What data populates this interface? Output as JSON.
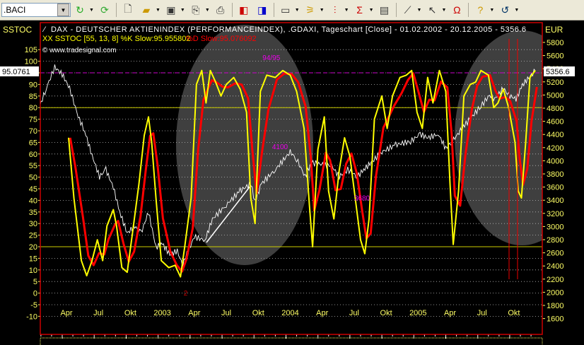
{
  "toolbar": {
    "symbol": ".BACI",
    "icons": [
      "go-arrow-icon",
      "refresh-icon",
      "new-document-icon",
      "open-folder-icon",
      "save-icon",
      "copy-icon",
      "print-icon",
      "chart-prev-icon",
      "chart-next-icon",
      "window-icon",
      "indicator-icon",
      "candlestick-icon",
      "sigma-icon",
      "properties-icon",
      "draw-line-icon",
      "cursor-icon",
      "magnet-icon",
      "help-icon",
      "undo-icon"
    ]
  },
  "colors": {
    "k": "#ffff00",
    "d": "#ff0000",
    "dax": "#ffffff",
    "level95": "#cc00cc",
    "frame": "#cc0000",
    "axis": "#ffff66"
  },
  "chart_data": {
    "type": "line",
    "title": "DAX - DEUTSCHER AKTIENINDEX (PERFORMANCEINDEX), .GDAXI, Tageschart [Close] - 01.02.2002 - 20.12.2005 - 5356.6",
    "indicator_legend": "XX SSTOC [55, 13, 8] %K Slow:95.955802",
    "indicator_legend_d": "%D Slow:95.076092",
    "copyright": "© www.tradesignal.com",
    "left_axis_title": "SSTOC",
    "right_axis_title": "EUR",
    "left_current": "95.0761",
    "right_current": "5356.6",
    "left_ticks": [
      105,
      100,
      95,
      90,
      85,
      80,
      75,
      70,
      65,
      60,
      55,
      50,
      45,
      40,
      35,
      30,
      25,
      20,
      15,
      10,
      5,
      0,
      -5,
      -10
    ],
    "right_ticks": [
      5800,
      5600,
      5400,
      5200,
      5000,
      4800,
      4600,
      4400,
      4200,
      4000,
      3800,
      3600,
      3400,
      3200,
      3000,
      2800,
      2600,
      2400,
      2200,
      2000,
      1800,
      1600
    ],
    "x_labels": [
      {
        "m": 3,
        "t": "Apr"
      },
      {
        "m": 6,
        "t": "Jul"
      },
      {
        "m": 9,
        "t": "Okt"
      },
      {
        "m": 12,
        "t": "2003"
      },
      {
        "m": 15,
        "t": "Apr"
      },
      {
        "m": 18,
        "t": "Jul"
      },
      {
        "m": 21,
        "t": "Okt"
      },
      {
        "m": 24,
        "t": "2004"
      },
      {
        "m": 27,
        "t": "Apr"
      },
      {
        "m": 30,
        "t": "Jul"
      },
      {
        "m": 33,
        "t": "Okt"
      },
      {
        "m": 36,
        "t": "2005"
      },
      {
        "m": 39,
        "t": "Apr"
      },
      {
        "m": 42,
        "t": "Jul"
      },
      {
        "m": 45,
        "t": "Okt"
      }
    ],
    "x_unit": "months since Jan 2002",
    "levels": [
      {
        "v": 95,
        "style": "dashed-magenta"
      },
      {
        "v": 80,
        "style": "yellow"
      },
      {
        "v": 20,
        "style": "yellow"
      }
    ],
    "annotations": [
      {
        "t": "94/95",
        "m": 21.4,
        "v": 100.5
      },
      {
        "t": "4100",
        "m": 22.3,
        "v": 62
      },
      {
        "t": "3680",
        "m": 30,
        "v": 40
      },
      {
        "t": "2",
        "m": 14.0,
        "v": -1
      }
    ],
    "series": [
      {
        "name": "%K Slow",
        "axis": "left",
        "points": [
          [
            3.2,
            67
          ],
          [
            3.7,
            41
          ],
          [
            4.4,
            14
          ],
          [
            4.9,
            7.5
          ],
          [
            5.4,
            14
          ],
          [
            5.9,
            23
          ],
          [
            6.4,
            14
          ],
          [
            6.8,
            29
          ],
          [
            7.4,
            36
          ],
          [
            7.7,
            29
          ],
          [
            8.2,
            11
          ],
          [
            8.7,
            9
          ],
          [
            9.2,
            26
          ],
          [
            9.8,
            47
          ],
          [
            10.3,
            68
          ],
          [
            10.7,
            76
          ],
          [
            11.0,
            65
          ],
          [
            11.4,
            41
          ],
          [
            11.9,
            14
          ],
          [
            12.6,
            11
          ],
          [
            13.2,
            12
          ],
          [
            13.7,
            7
          ],
          [
            14.1,
            20
          ],
          [
            14.7,
            41
          ],
          [
            15.2,
            90
          ],
          [
            15.7,
            96
          ],
          [
            16.1,
            82
          ],
          [
            16.5,
            96
          ],
          [
            17.0,
            91
          ],
          [
            17.5,
            85
          ],
          [
            18.0,
            90
          ],
          [
            18.7,
            93
          ],
          [
            19.3,
            88
          ],
          [
            19.9,
            78
          ],
          [
            20.3,
            41
          ],
          [
            20.7,
            30
          ],
          [
            21.2,
            87
          ],
          [
            21.8,
            94
          ],
          [
            22.6,
            93
          ],
          [
            23.3,
            96
          ],
          [
            24.0,
            94
          ],
          [
            24.6,
            87
          ],
          [
            25.3,
            71
          ],
          [
            25.8,
            38
          ],
          [
            26.1,
            20
          ],
          [
            26.6,
            62
          ],
          [
            27.2,
            76
          ],
          [
            27.6,
            44
          ],
          [
            28.1,
            32
          ],
          [
            28.6,
            53
          ],
          [
            29.1,
            67
          ],
          [
            29.6,
            59
          ],
          [
            30.1,
            41
          ],
          [
            30.6,
            23
          ],
          [
            31.0,
            17
          ],
          [
            31.4,
            32
          ],
          [
            31.9,
            75
          ],
          [
            32.6,
            85
          ],
          [
            33.1,
            71
          ],
          [
            33.6,
            85
          ],
          [
            34.3,
            93
          ],
          [
            34.9,
            94
          ],
          [
            35.4,
            96
          ],
          [
            35.9,
            78
          ],
          [
            36.4,
            71
          ],
          [
            36.9,
            93
          ],
          [
            37.4,
            82
          ],
          [
            38.0,
            96
          ],
          [
            38.6,
            87
          ],
          [
            39.0,
            47
          ],
          [
            39.3,
            21
          ],
          [
            39.8,
            44
          ],
          [
            40.3,
            85
          ],
          [
            40.9,
            90
          ],
          [
            41.4,
            91
          ],
          [
            41.9,
            96
          ],
          [
            42.6,
            94
          ],
          [
            43.1,
            80
          ],
          [
            43.5,
            82
          ],
          [
            44.0,
            88
          ],
          [
            44.5,
            80
          ],
          [
            45.1,
            65
          ],
          [
            45.4,
            44
          ],
          [
            45.7,
            41
          ],
          [
            46.1,
            65
          ],
          [
            46.5,
            93
          ],
          [
            47.0,
            96
          ]
        ]
      },
      {
        "name": "DAX",
        "axis": "right",
        "points": [
          [
            0.5,
            4832
          ],
          [
            1.1,
            5101
          ],
          [
            1.9,
            5424
          ],
          [
            2.6,
            5316
          ],
          [
            3.3,
            5101
          ],
          [
            4.1,
            4671
          ],
          [
            4.7,
            4456
          ],
          [
            5.4,
            4080
          ],
          [
            6.1,
            3757
          ],
          [
            6.7,
            3865
          ],
          [
            7.4,
            3596
          ],
          [
            8.0,
            3220
          ],
          [
            8.7,
            2898
          ],
          [
            9.4,
            3005
          ],
          [
            10.0,
            2898
          ],
          [
            10.7,
            3220
          ],
          [
            11.4,
            2683
          ],
          [
            12.0,
            2737
          ],
          [
            12.7,
            2575
          ],
          [
            13.4,
            2629
          ],
          [
            13.9,
            2414
          ],
          [
            14.3,
            2575
          ],
          [
            15.0,
            2844
          ],
          [
            16.0,
            2790
          ],
          [
            16.7,
            3113
          ],
          [
            18.0,
            3328
          ],
          [
            19.3,
            3543
          ],
          [
            20.3,
            3650
          ],
          [
            20.7,
            3381
          ],
          [
            21.3,
            3650
          ],
          [
            22.6,
            3865
          ],
          [
            24.0,
            4134
          ],
          [
            24.6,
            4026
          ],
          [
            25.4,
            3758
          ],
          [
            26.0,
            3973
          ],
          [
            26.8,
            3951
          ],
          [
            27.9,
            3919
          ],
          [
            28.6,
            3758
          ],
          [
            29.4,
            3865
          ],
          [
            30.3,
            3758
          ],
          [
            30.9,
            3865
          ],
          [
            31.6,
            3973
          ],
          [
            32.6,
            4134
          ],
          [
            33.9,
            4241
          ],
          [
            35.3,
            4295
          ],
          [
            36.2,
            4403
          ],
          [
            36.9,
            4349
          ],
          [
            37.9,
            4403
          ],
          [
            38.6,
            4188
          ],
          [
            39.2,
            4295
          ],
          [
            40.5,
            4564
          ],
          [
            41.9,
            4832
          ],
          [
            42.7,
            4994
          ],
          [
            43.2,
            4940
          ],
          [
            44.0,
            5101
          ],
          [
            44.5,
            4994
          ],
          [
            45.2,
            4940
          ],
          [
            45.8,
            5155
          ],
          [
            47.0,
            5370
          ]
        ]
      }
    ]
  }
}
